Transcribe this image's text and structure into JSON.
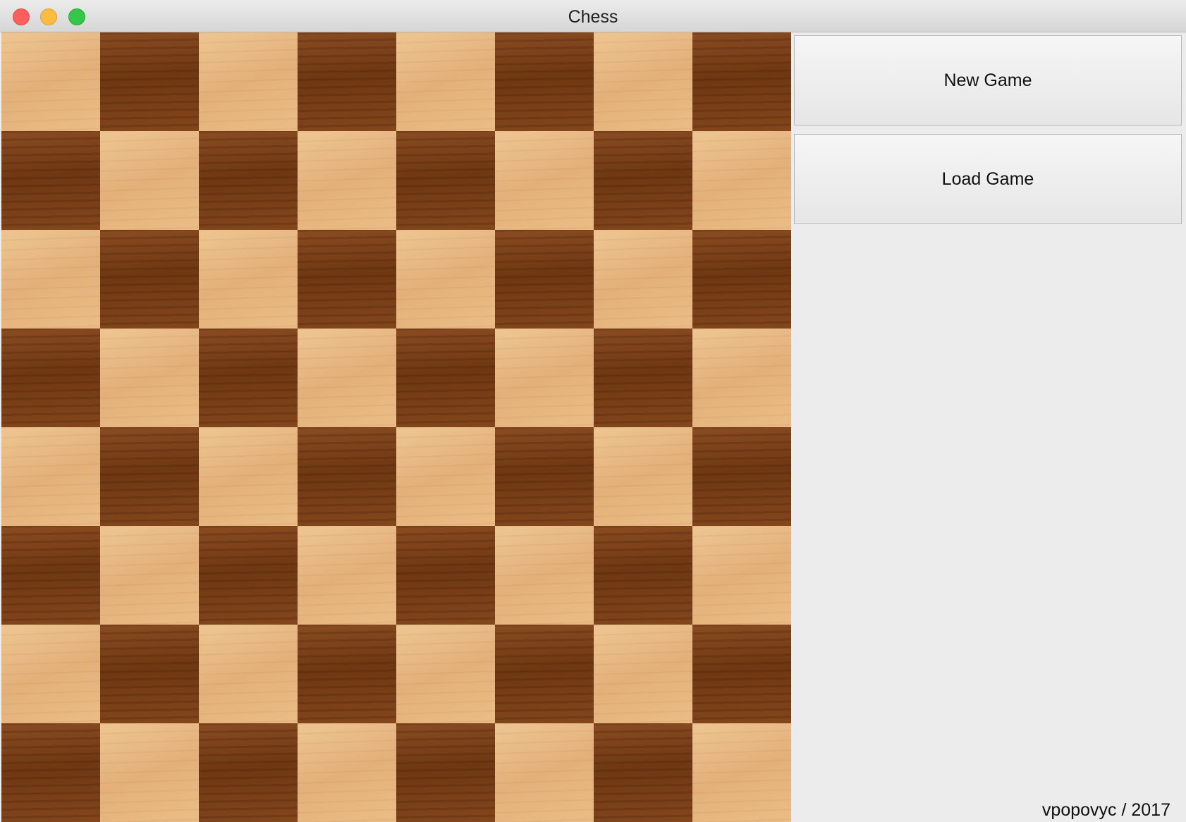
{
  "window": {
    "title": "Chess",
    "controls": [
      "close",
      "minimize",
      "zoom"
    ]
  },
  "board": {
    "rows": 8,
    "cols": 8,
    "top_left_square": "light",
    "colors": {
      "light": "#e8b882",
      "dark": "#7a4018"
    }
  },
  "sidebar": {
    "new_game_label": "New Game",
    "load_game_label": "Load Game",
    "credit": "vpopovyc / 2017"
  }
}
